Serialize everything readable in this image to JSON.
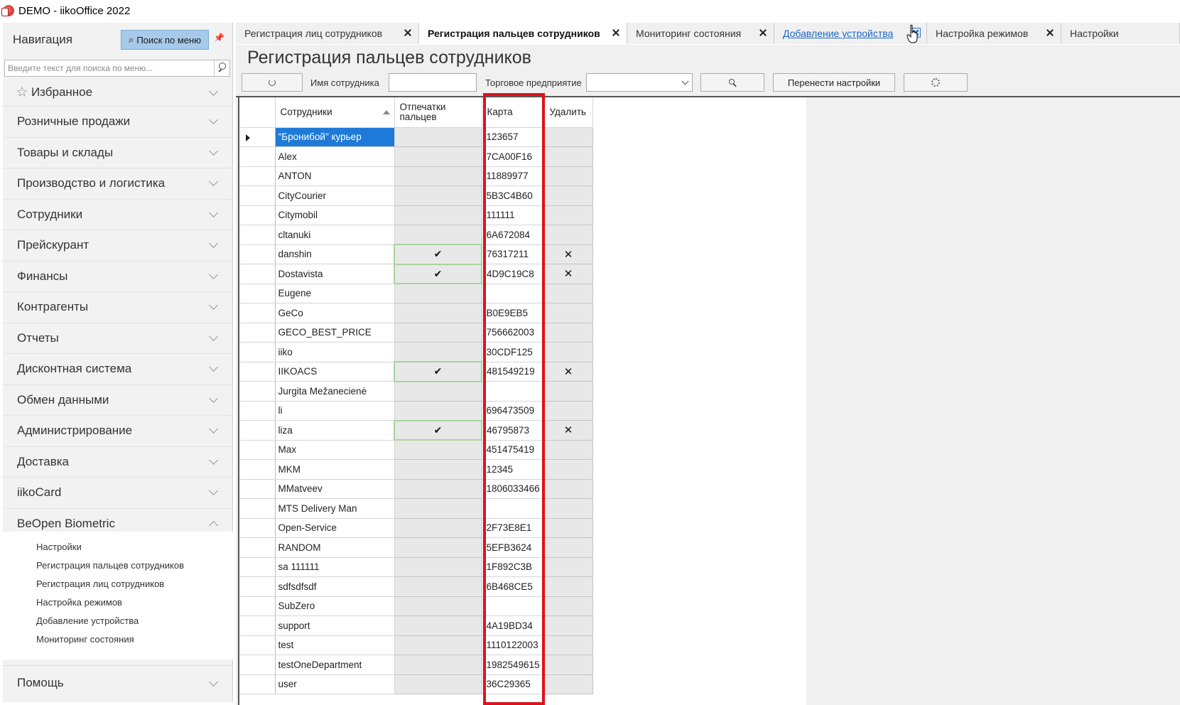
{
  "window": {
    "title": "DEMO - iikoOffice 2022"
  },
  "nav": {
    "title": "Навигация",
    "menu_search_label": "Поиск по меню",
    "search_placeholder": "Введите текст для поиска по меню...",
    "groups": [
      "Избранное",
      "Розничные продажи",
      "Товары и склады",
      "Производство и логистика",
      "Сотрудники",
      "Прейскурант",
      "Финансы",
      "Контрагенты",
      "Отчеты",
      "Дисконтная система",
      "Обмен данными",
      "Администрирование",
      "Доставка",
      "iikoCard",
      "BeOpen Biometric"
    ],
    "sub_items": [
      "Настройки",
      "Регистрация пальцев сотрудников",
      "Регистрация лиц сотрудников",
      "Настройка режимов",
      "Добавление устройства",
      "Мониторинг состояния"
    ],
    "help": "Помощь"
  },
  "tabs": [
    {
      "label": "Регистрация лиц сотрудников"
    },
    {
      "label": "Регистрация пальцев сотрудников"
    },
    {
      "label": "Мониторинг состояния"
    },
    {
      "label": "Добавление устройства"
    },
    {
      "label": "Настройка режимов"
    },
    {
      "label": "Настройки"
    }
  ],
  "page": {
    "title": "Регистрация пальцев сотрудников",
    "employee_name_label": "Имя сотрудника",
    "employee_name_value": "",
    "store_label": "Торговое предприятие",
    "store_value": "",
    "transfer_button": "Перенести настройки"
  },
  "grid": {
    "columns": {
      "employees": "Сотрудники",
      "fingerprints_line1": "Отпечатки",
      "fingerprints_line2": "пальцев",
      "card": "Карта",
      "delete": "Удалить"
    },
    "check_mark": "✔",
    "x_mark": "✕",
    "rows": [
      {
        "name": "\"Бронибой\" курьер",
        "card": "123657",
        "fp": false
      },
      {
        "name": "Alex",
        "card": "7CA00F16",
        "fp": false
      },
      {
        "name": "ANTON",
        "card": "11889977",
        "fp": false
      },
      {
        "name": "CityCourier",
        "card": "5B3C4B60",
        "fp": false
      },
      {
        "name": "Citymobil",
        "card": "111111",
        "fp": false
      },
      {
        "name": "cltanuki",
        "card": "6A672084",
        "fp": false
      },
      {
        "name": "danshin",
        "card": "76317211",
        "fp": true
      },
      {
        "name": "Dostavista",
        "card": "4D9C19C8",
        "fp": true
      },
      {
        "name": "Eugene",
        "card": "",
        "fp": false
      },
      {
        "name": "GeCo",
        "card": "B0E9EB5",
        "fp": false
      },
      {
        "name": "GECO_BEST_PRICE",
        "card": "756662003",
        "fp": false
      },
      {
        "name": "iiko",
        "card": "30CDF125",
        "fp": false
      },
      {
        "name": "IIKOACS",
        "card": "481549219",
        "fp": true
      },
      {
        "name": "Jurgita Mežanecienė",
        "card": "",
        "fp": false
      },
      {
        "name": "li",
        "card": "696473509",
        "fp": false
      },
      {
        "name": "liza",
        "card": "46795873",
        "fp": true
      },
      {
        "name": "Max",
        "card": "451475419",
        "fp": false
      },
      {
        "name": "MKM",
        "card": "12345",
        "fp": false
      },
      {
        "name": "MMatveev",
        "card": "1806033466",
        "fp": false
      },
      {
        "name": "MTS Delivery Man",
        "card": "",
        "fp": false
      },
      {
        "name": "Open-Service",
        "card": "2F73E8E1",
        "fp": false
      },
      {
        "name": "RANDOM",
        "card": "5EFB3624",
        "fp": false
      },
      {
        "name": "sa 111111",
        "card": "1F892C3B",
        "fp": false
      },
      {
        "name": "sdfsdfsdf",
        "card": "6B468CE5",
        "fp": false
      },
      {
        "name": "SubZero",
        "card": "",
        "fp": false
      },
      {
        "name": "support",
        "card": "4A19BD34",
        "fp": false
      },
      {
        "name": "test",
        "card": "1110122003",
        "fp": false
      },
      {
        "name": "testOneDepartment",
        "card": "1982549615",
        "fp": false
      },
      {
        "name": "user",
        "card": "36C29365",
        "fp": false
      }
    ]
  },
  "colors": {
    "selection": "#1e7ad8",
    "highlight": "#e0111b",
    "link": "#1a66c7"
  }
}
